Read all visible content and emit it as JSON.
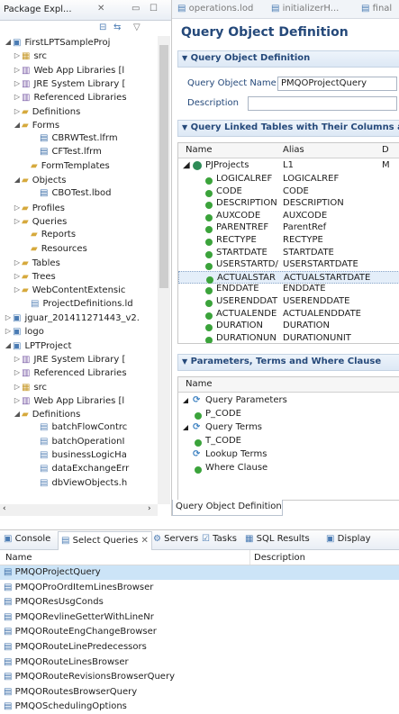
{
  "package_explorer": {
    "tab_label": "Package Expl...",
    "tree": [
      {
        "label": "FirstLPTSampleProj",
        "icon": "project-icon",
        "indent": 0,
        "expanded": true
      },
      {
        "label": "src",
        "icon": "source-folder-icon",
        "indent": 1,
        "expanded": false
      },
      {
        "label": "Web App Libraries [l",
        "icon": "library-icon",
        "indent": 1,
        "expanded": false
      },
      {
        "label": "JRE System Library [",
        "icon": "library-icon",
        "indent": 1,
        "expanded": false
      },
      {
        "label": "Referenced Libraries",
        "icon": "library-icon",
        "indent": 1,
        "expanded": false
      },
      {
        "label": "Definitions",
        "icon": "folder-icon",
        "indent": 1,
        "expanded": false
      },
      {
        "label": "Forms",
        "icon": "folder-icon",
        "indent": 1,
        "expanded": true
      },
      {
        "label": "CBRWTest.lfrm",
        "icon": "form-file-icon",
        "indent": 3,
        "expanded": null
      },
      {
        "label": "CFTest.lfrm",
        "icon": "form-file-icon",
        "indent": 3,
        "expanded": null
      },
      {
        "label": "FormTemplates",
        "icon": "folder-icon",
        "indent": 2,
        "expanded": null
      },
      {
        "label": "Objects",
        "icon": "folder-icon",
        "indent": 1,
        "expanded": true
      },
      {
        "label": "CBOTest.lbod",
        "icon": "object-file-icon",
        "indent": 3,
        "expanded": null
      },
      {
        "label": "Profiles",
        "icon": "folder-icon",
        "indent": 1,
        "expanded": false
      },
      {
        "label": "Queries",
        "icon": "folder-icon",
        "indent": 1,
        "expanded": false
      },
      {
        "label": "Reports",
        "icon": "folder-icon",
        "indent": 2,
        "expanded": null
      },
      {
        "label": "Resources",
        "icon": "folder-icon",
        "indent": 2,
        "expanded": null
      },
      {
        "label": "Tables",
        "icon": "folder-icon",
        "indent": 1,
        "expanded": false
      },
      {
        "label": "Trees",
        "icon": "folder-icon",
        "indent": 1,
        "expanded": false
      },
      {
        "label": "WebContentExtensic",
        "icon": "folder-icon",
        "indent": 1,
        "expanded": false
      },
      {
        "label": "ProjectDefinitions.ld",
        "icon": "file-icon",
        "indent": 2,
        "expanded": null
      },
      {
        "label": "jguar_201411271443_v2.",
        "icon": "project-icon",
        "indent": 0,
        "expanded": false
      },
      {
        "label": "logo",
        "icon": "project-icon",
        "indent": 0,
        "expanded": false
      },
      {
        "label": "LPTProject",
        "icon": "project-icon",
        "indent": 0,
        "expanded": true
      },
      {
        "label": "JRE System Library [",
        "icon": "library-icon",
        "indent": 1,
        "expanded": false
      },
      {
        "label": "Referenced Libraries",
        "icon": "library-icon",
        "indent": 1,
        "expanded": false
      },
      {
        "label": "src",
        "icon": "source-folder-icon",
        "indent": 1,
        "expanded": false
      },
      {
        "label": "Web App Libraries [l",
        "icon": "library-icon",
        "indent": 1,
        "expanded": false
      },
      {
        "label": "Definitions",
        "icon": "folder-icon",
        "indent": 1,
        "expanded": true
      },
      {
        "label": "batchFlowContrc",
        "icon": "file-icon",
        "indent": 3,
        "expanded": null
      },
      {
        "label": "batchOperationI",
        "icon": "file-icon",
        "indent": 3,
        "expanded": null
      },
      {
        "label": "businessLogicHa",
        "icon": "file-icon",
        "indent": 3,
        "expanded": null
      },
      {
        "label": "dataExchangeErr",
        "icon": "file-icon",
        "indent": 3,
        "expanded": null
      },
      {
        "label": "dbViewObjects.h",
        "icon": "file-icon",
        "indent": 3,
        "expanded": null
      }
    ]
  },
  "editor": {
    "tabs": [
      "operations.lod",
      "initializerH...",
      "final"
    ],
    "form_title": "Query Object Definition",
    "section1_title": "Query Object Definition",
    "qo_name_label": "Query Object Name",
    "qo_name_value": "PMQOProjectQuery",
    "description_label": "Description",
    "description_value": "",
    "section2_title": "Query Linked Tables with Their Columns and O",
    "linked_headers": [
      "Name",
      "Alias",
      "D"
    ],
    "linked_root": {
      "name": "PJProjects",
      "alias": "L1",
      "d": "M"
    },
    "linked_rows": [
      {
        "name": "LOGICALREF",
        "alias": "LOGICALREF"
      },
      {
        "name": "CODE",
        "alias": "CODE"
      },
      {
        "name": "DESCRIPTION",
        "alias": "DESCRIPTION"
      },
      {
        "name": "AUXCODE",
        "alias": "AUXCODE"
      },
      {
        "name": "PARENTREF",
        "alias": "ParentRef"
      },
      {
        "name": "RECTYPE",
        "alias": "RECTYPE"
      },
      {
        "name": "STARTDATE",
        "alias": "STARTDATE"
      },
      {
        "name": "USERSTARTD/",
        "alias": "USERSTARTDATE"
      },
      {
        "name": "ACTUALSTAR",
        "alias": "ACTUALSTARTDATE"
      },
      {
        "name": "ENDDATE",
        "alias": "ENDDATE"
      },
      {
        "name": "USERENDDAT",
        "alias": "USERENDDATE"
      },
      {
        "name": "ACTUALENDE",
        "alias": "ACTUALENDDATE"
      },
      {
        "name": "DURATION",
        "alias": "DURATION"
      },
      {
        "name": "DURATIONUN",
        "alias": "DURATIONUNIT"
      }
    ],
    "selected_linked_index": 8,
    "section3_title": "Parameters, Terms and Where Clause",
    "params_header": "Name",
    "params_rows": [
      {
        "label": "Query Parameters",
        "type": "group",
        "expanded": true
      },
      {
        "label": "P_CODE",
        "type": "item"
      },
      {
        "label": "Query Terms",
        "type": "group",
        "expanded": true
      },
      {
        "label": "T_CODE",
        "type": "item"
      },
      {
        "label": "Lookup Terms",
        "type": "group",
        "expanded": null
      },
      {
        "label": "Where Clause",
        "type": "item"
      }
    ],
    "bottom_tab": "Query Object Definition"
  },
  "bottom_panel": {
    "tabs": [
      "Console",
      "Select Queries",
      "Servers",
      "Tasks",
      "SQL Results",
      "Display"
    ],
    "headers": [
      "Name",
      "Description"
    ],
    "rows": [
      "PMQOProjectQuery",
      "PMQOProOrdItemLinesBrowser",
      "PMQOResUsgConds",
      "PMQORevlineGetterWithLineNr",
      "PMQORouteEngChangeBrowser",
      "PMQORouteLinePredecessors",
      "PMQORouteLinesBrowser",
      "PMQORouteRevisionsBrowserQuery",
      "PMQORoutesBrowserQuery",
      "PMQOSchedulingOptions"
    ],
    "selected_index": 0
  }
}
